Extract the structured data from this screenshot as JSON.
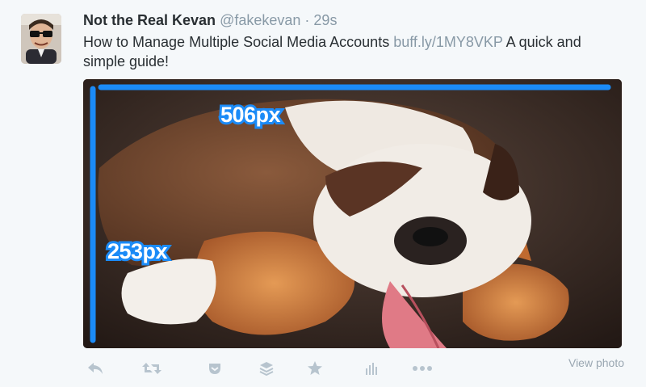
{
  "tweet": {
    "author_name": "Not the Real Kevan",
    "handle": "@fakekevan",
    "separator": "·",
    "time": "29s",
    "text_before": "How to Manage Multiple Social Media Accounts ",
    "link": "buff.ly/1MY8VKP",
    "text_after": "  A quick and simple guide!"
  },
  "media": {
    "width_label": "506px",
    "height_label": "253px",
    "measure_color": "#1b8bf7"
  },
  "actions": {
    "icons": [
      "reply-icon",
      "retweet-icon",
      "pocket-icon",
      "buffer-icon",
      "favorite-icon",
      "analytics-icon",
      "more-icon"
    ],
    "view_photo_label": "View photo",
    "icon_color": "#b7c4ce"
  }
}
